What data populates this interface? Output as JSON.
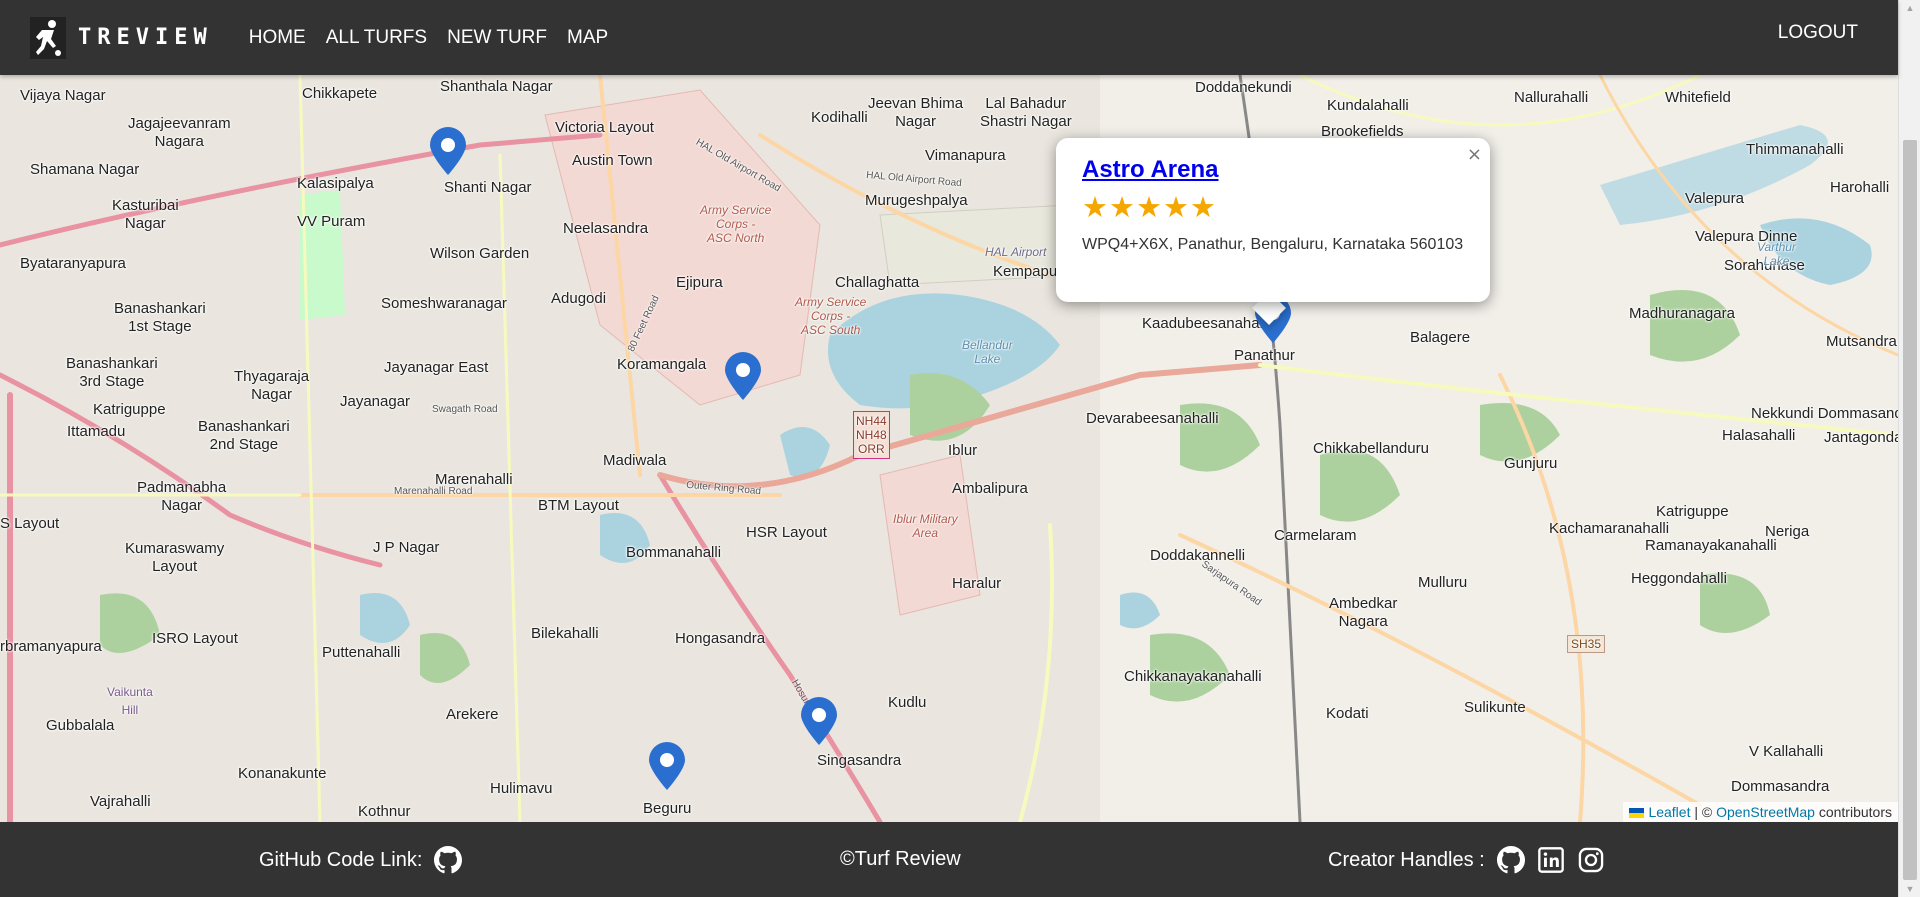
{
  "navbar": {
    "brand": "TREVIEW",
    "links": [
      "HOME",
      "ALL TURFS",
      "NEW TURF",
      "MAP"
    ],
    "logout": "LOGOUT"
  },
  "map": {
    "places": {
      "vijayanagar": "Vijaya Nagar",
      "chikkapete": "Chikkapete",
      "shanthalanagar": "Shanthala Nagar",
      "victorialayout": "Victoria Layout",
      "jeevanbhima": "Jeevan Bhima\nNagar",
      "lalbahadur": "Lal Bahadur\nShastri Nagar",
      "doddanekundi": "Doddanekundi",
      "kundalahalli": "Kundalahalli",
      "brookefields": "Brookefields",
      "nallurahalli": "Nallurahalli",
      "whitefield": "Whitefield",
      "jagajeevanram": "Jagajeevanram\nNagara",
      "shamana": "Shamana Nagar",
      "austintown": "Austin Town",
      "kodihalli": "Kodihalli",
      "vimanapura": "Vimanapura",
      "thimmanahalli": "Thimmanahalli",
      "harohalli": "Harohalli",
      "kalasipalya": "Kalasipalya",
      "shantinagar": "Shanti Nagar",
      "murugesh": "Murugeshpalya",
      "kasturibai": "Kasturibai\nNagar",
      "vvpuram": "VV Puram",
      "neelasandra": "Neelasandra",
      "valepura": "Valepura",
      "valepuradinne": "Valepura Dinne",
      "byatarayanapura": "Byataranyapura",
      "wilsongarden": "Wilson Garden",
      "ejipura": "Ejipura",
      "challaghatta": "Challaghatta",
      "kempapura": "Kempapura",
      "sorahunase": "Sorahunase",
      "adugodi": "Adugodi",
      "someshwara": "Someshwaranagar",
      "banashankari1": "Banashankari\n1st Stage",
      "kadubeesanahalli": "Kaadubeesanahalli",
      "balagere": "Balagere",
      "madhuranagara": "Madhuranagara",
      "mutsandra": "Mutsandra",
      "banashankari3": "Banashankari\n3rd Stage",
      "thyagaraja": "Thyagaraja\nNagar",
      "jayanagareast": "Jayanagar East",
      "koramangala": "Koramangala",
      "panathur": "Panathur",
      "katriguppe": "Katriguppe",
      "jayanagar": "Jayanagar",
      "ittamadu": "Ittamadu",
      "devarabeesanahalli": "Devarabeesanahalli",
      "nekkundi": "Nekkundi Dommasandra",
      "banashankari2": "Banashankari\n2nd Stage",
      "halasahalli": "Halasahalli",
      "jantagondanahalli": "Jantagondanahalli",
      "madiwala": "Madiwala",
      "iblur": "Iblur",
      "chikkabellanduru": "Chikkabellanduru",
      "marenahalli": "Marenahalli",
      "gunjuru": "Gunjuru",
      "padmanabha": "Padmanabha\nNagar",
      "ambalipura": "Ambalipura",
      "btmlayout": "BTM Layout",
      "katriguppe2": "Katriguppe",
      "slayout": "S Layout",
      "kachamaranahalli": "Kachamaranahalli",
      "neriga": "Neriga",
      "hsrlayout": "HSR Layout",
      "carmelaram": "Carmelaram",
      "jpnagar": "J P Nagar",
      "kumaraswamy": "Kumaraswamy\nLayout",
      "bommanahalli": "Bommanahalli",
      "ramanayakanahalli": "Ramanayakanahalli",
      "doddakannelli": "Doddakannelli",
      "haralur": "Haralur",
      "mulluru": "Mulluru",
      "heggondahalli": "Heggondahalli",
      "ambedkar": "Ambedkar\nNagara",
      "bilekahalli": "Bilekahalli",
      "hongasandra": "Hongasandra",
      "isro": "ISRO Layout",
      "rbramanyapura": "rbramanyapura",
      "puttenahalli": "Puttenahalli",
      "chikkanayakanahalli": "Chikkanayakanahalli",
      "kudlu": "Kudlu",
      "arekere": "Arekere",
      "kodati": "Kodati",
      "sulikunte": "Sulikunte",
      "gubbalala": "Gubbalala",
      "singasandra": "Singasandra",
      "vkallahalli": "V Kallahalli",
      "konanakunte": "Konanakunte",
      "hulimavu": "Hulimavu",
      "dommasandra": "Dommasandra",
      "vajrahalli": "Vajrahalli",
      "kothnur": "Kothnur",
      "beguru": "Beguru",
      "vaikunta": "Vaikunta\nHill",
      "asc_north": "Army Service\nCorps -\nASC North",
      "asc_south": "Army Service\nCorps -\nASC South",
      "hal_airport": "HAL Airport",
      "bellandur_lake": "Bellandur\nLake",
      "varthur_lake": "Varthur\nLake",
      "iblur_military": "Iblur Military\nArea",
      "nh44": "NH44\nNH48\nORR",
      "sh35": "SH35"
    },
    "roads": {
      "hal_old_airport": "HAL Old Airport Road",
      "hal_old_airport2": "HAL Old Airport Road",
      "outer_ring": "Outer Ring Road",
      "marenahalli_rd": "Marenahalli Road",
      "sarjapura": "Sarjapura Road",
      "swagath": "Swagath Road",
      "feet80": "80 Feet Road",
      "hosur": "Hosur Road"
    }
  },
  "popup": {
    "title": "Astro Arena",
    "rating": 5,
    "stars": "★★★★★",
    "address": "WPQ4+X6X, Panathur, Bengaluru, Karnataka 560103",
    "close": "×"
  },
  "attribution": {
    "leaflet": "Leaflet",
    "separator": "| ©",
    "osm": "OpenStreetMap",
    "suffix": "contributors"
  },
  "footer": {
    "github_label": "GitHub Code Link:",
    "copyright": "©Turf Review",
    "creators_label": "Creator Handles :"
  },
  "colors": {
    "bar": "#333333",
    "pin": "#2a6fcf",
    "star": "#f4a700",
    "link": "#0000ee"
  }
}
